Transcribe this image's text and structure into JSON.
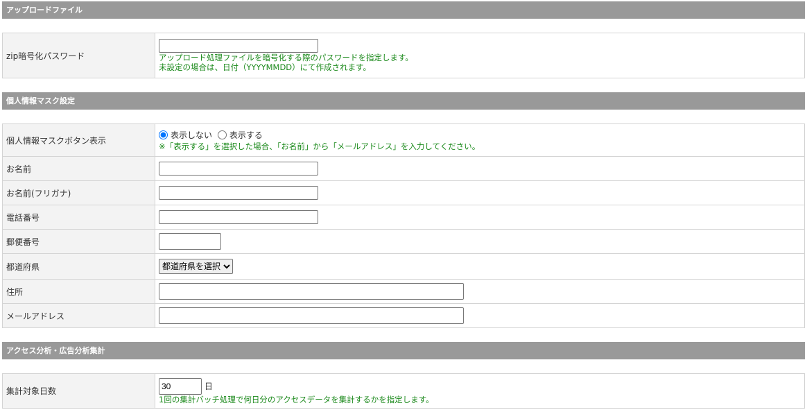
{
  "sections": [
    {
      "title": "アップロードファイル"
    },
    {
      "title": "個人情報マスク設定"
    },
    {
      "title": "アクセス分析・広告分析集計"
    }
  ],
  "upload": {
    "label": "zip暗号化パスワード",
    "value": "",
    "note1": "アップロード処理ファイルを暗号化する際のパスワードを指定します。",
    "note2": "未設定の場合は、日付（YYYYMMDD）にて作成されます。"
  },
  "mask": {
    "button_label": "個人情報マスクボタン表示",
    "option_hide": "表示しない",
    "option_show": "表示する",
    "selected": "表示しない",
    "note": "※「表示する」を選択した場合、「お名前」から「メールアドレス」を入力してください。",
    "name": "お名前",
    "kana": "お名前(フリガナ)",
    "tel": "電話番号",
    "zip": "郵便番号",
    "pref": "都道府県",
    "pref_select": "都道府県を選択",
    "address": "住所",
    "email": "メールアドレス"
  },
  "access": {
    "label": "集計対象日数",
    "value": "30",
    "unit": "日",
    "note": "1回の集計バッチ処理で何日分のアクセスデータを集計するかを指定します。"
  }
}
